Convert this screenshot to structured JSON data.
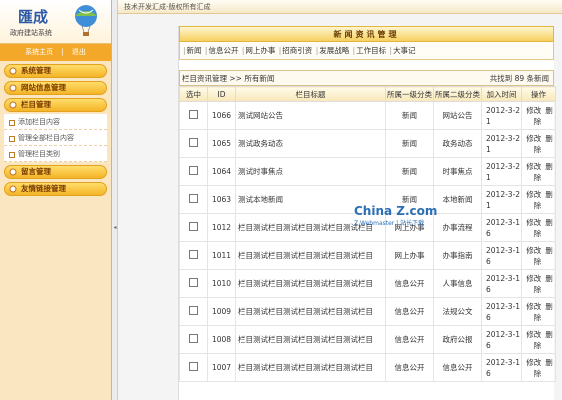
{
  "logo": {
    "title": "匯成",
    "subtitle": "政府建站系统"
  },
  "userbar": {
    "left": "系统主页",
    "sep": "|",
    "right": "退出"
  },
  "sidebar": {
    "groups": [
      {
        "label": "系统管理"
      },
      {
        "label": "网站信息管理"
      },
      {
        "label": "栏目管理"
      }
    ],
    "submenu": [
      {
        "label": "添加栏目内容"
      },
      {
        "label": "管理全部栏目内容"
      },
      {
        "label": "管理栏目类别"
      }
    ],
    "groups2": [
      {
        "label": "留言管理"
      },
      {
        "label": "友情链接管理"
      }
    ]
  },
  "topbar": {
    "text": "技术开发汇成-版权所有汇成"
  },
  "panel": {
    "title": "新闻资讯管理",
    "nav": [
      "新闻",
      "信息公开",
      "网上办事",
      "招商引资",
      "发展战略",
      "工作目标",
      "大事记"
    ],
    "breadcrumb": "栏目资讯管理 >> 所有新闻",
    "total": "共找到 89 条新闻"
  },
  "table": {
    "headers": [
      "选中",
      "ID",
      "栏目标题",
      "所属一级分类",
      "所属二级分类",
      "加入时间",
      "操作"
    ],
    "rows": [
      {
        "id": "1066",
        "title": "测试网站公告",
        "cat1": "新闻",
        "cat2": "网站公告",
        "time1": "2012-3-2",
        "time2": "1"
      },
      {
        "id": "1065",
        "title": "测试政务动态",
        "cat1": "新闻",
        "cat2": "政务动态",
        "time1": "2012-3-2",
        "time2": "1"
      },
      {
        "id": "1064",
        "title": "测试时事焦点",
        "cat1": "新闻",
        "cat2": "时事焦点",
        "time1": "2012-3-2",
        "time2": "1"
      },
      {
        "id": "1063",
        "title": "测试本地新闻",
        "cat1": "新闻",
        "cat2": "本地新闻",
        "time1": "2012-3-2",
        "time2": "1"
      },
      {
        "id": "1012",
        "title": "栏目测试栏目测试栏目测试栏目测试栏目",
        "cat1": "网上办事",
        "cat2": "办事流程",
        "time1": "2012-3-1",
        "time2": "6"
      },
      {
        "id": "1011",
        "title": "栏目测试栏目测试栏目测试栏目测试栏目",
        "cat1": "网上办事",
        "cat2": "办事指南",
        "time1": "2012-3-1",
        "time2": "6"
      },
      {
        "id": "1010",
        "title": "栏目测试栏目测试栏目测试栏目测试栏目",
        "cat1": "信息公开",
        "cat2": "人事信息",
        "time1": "2012-3-1",
        "time2": "6"
      },
      {
        "id": "1009",
        "title": "栏目测试栏目测试栏目测试栏目测试栏目",
        "cat1": "信息公开",
        "cat2": "法规公文",
        "time1": "2012-3-1",
        "time2": "6"
      },
      {
        "id": "1008",
        "title": "栏目测试栏目测试栏目测试栏目测试栏目",
        "cat1": "信息公开",
        "cat2": "政府公报",
        "time1": "2012-3-1",
        "time2": "6"
      },
      {
        "id": "1007",
        "title": "栏目测试栏目测试栏目测试栏目测试栏目",
        "cat1": "信息公开",
        "cat2": "信息公开",
        "time1": "2012-3-1",
        "time2": "6"
      }
    ],
    "edit_label": "修改",
    "delete_label": "删除"
  },
  "watermark": {
    "text": "China Z.com",
    "sub": "Z Webmaster | 站长下载"
  }
}
